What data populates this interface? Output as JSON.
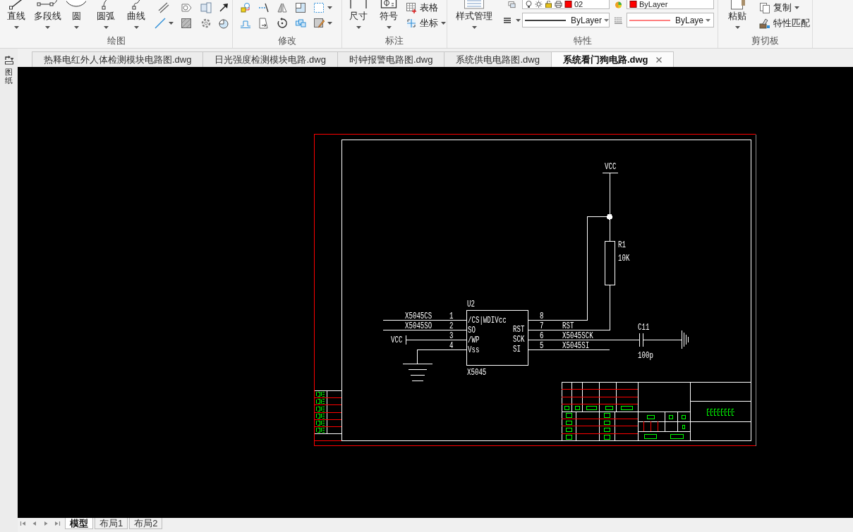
{
  "ribbon": {
    "draw": {
      "title": "绘图",
      "buttons": [
        {
          "label": "直线"
        },
        {
          "label": "多段线"
        },
        {
          "label": "圆"
        },
        {
          "label": "圆弧"
        },
        {
          "label": "曲线"
        }
      ]
    },
    "modify": {
      "title": "修改"
    },
    "annotate": {
      "title": "标注",
      "buttons": [
        {
          "label": "尺寸"
        },
        {
          "label": "符号"
        }
      ],
      "small_buttons": [
        {
          "label": "表格",
          "dropdown": false
        },
        {
          "label": "坐标",
          "dropdown": true
        }
      ]
    },
    "properties": {
      "title": "特性",
      "style_button": "样式管理",
      "combos": [
        {
          "kind": "layer",
          "value": "02"
        },
        {
          "kind": "object-color",
          "value": "ByLayer"
        },
        {
          "kind": "linetype",
          "value": "ByLayer"
        },
        {
          "kind": "lineweight",
          "value": "ByLaye"
        }
      ]
    },
    "clipboard": {
      "title": "剪切板",
      "paste": "粘贴",
      "small_buttons": [
        {
          "label": "复制",
          "dropdown": true
        },
        {
          "label": "特性匹配",
          "dropdown": false
        }
      ]
    }
  },
  "side_palette": {
    "label": "图纸"
  },
  "document_tabs": [
    {
      "label": "热释电红外人体检测模块电路图.dwg",
      "selected": false
    },
    {
      "label": "日光强度检测模块电路.dwg",
      "selected": false
    },
    {
      "label": "时钟报警电路图.dwg",
      "selected": false
    },
    {
      "label": "系统供电电路图.dwg",
      "selected": false
    },
    {
      "label": "系统看门狗电路.dwg",
      "selected": true
    }
  ],
  "drawing": {
    "power_label": "VCC",
    "resistor": {
      "ref": "R1",
      "value": "10K"
    },
    "capacitor": {
      "ref": "C11",
      "value": "100p"
    },
    "chip": {
      "ref": "U2",
      "part": "X5045",
      "left_pins": [
        {
          "kind": "net",
          "number": "1",
          "name": "/CS|WDIVcc",
          "net": "X5045CS"
        },
        {
          "kind": "net",
          "number": "2",
          "name": "SO",
          "net": "X5045SO"
        },
        {
          "kind": "power",
          "number": "3",
          "name": "/WP",
          "net": "VCC"
        },
        {
          "kind": "ground",
          "number": "4",
          "name": "Vss"
        }
      ],
      "right_pins": [
        {
          "kind": "junction",
          "number": "8"
        },
        {
          "kind": "resistor",
          "number": "7",
          "name": "RST",
          "net": "RST"
        },
        {
          "kind": "capacitor",
          "number": "6",
          "name": "SCK",
          "net": "X5045SCK"
        },
        {
          "kind": "open",
          "number": "5",
          "name": "SI",
          "net": "X5045SI"
        }
      ]
    }
  },
  "layout_tabs": [
    {
      "label": "模型",
      "selected": true
    },
    {
      "label": "布局1",
      "selected": false
    },
    {
      "label": "布局2",
      "selected": false
    }
  ]
}
